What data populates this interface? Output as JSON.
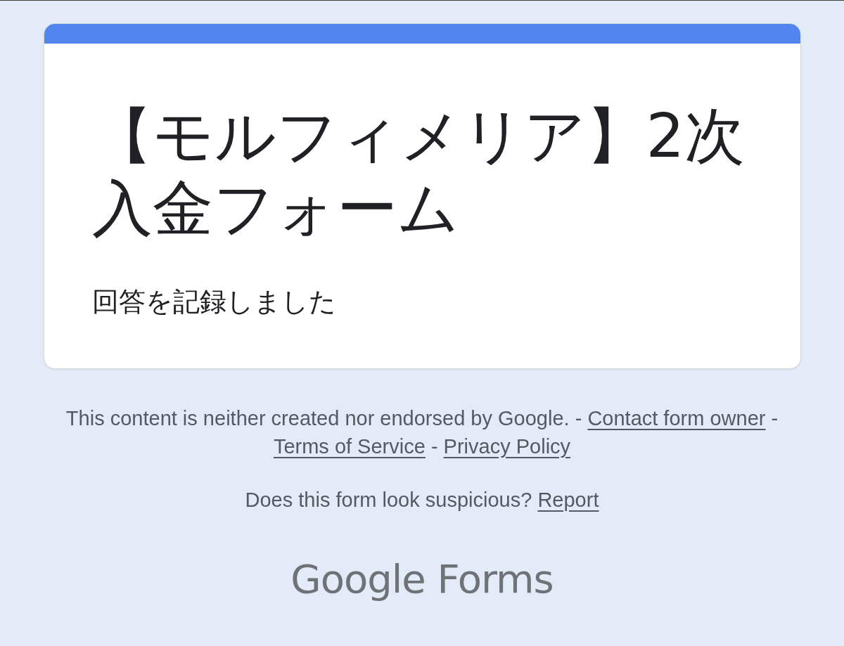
{
  "form": {
    "title": "【モルフィメリア】2次入金フォーム",
    "message": "回答を記録しました"
  },
  "footer": {
    "disclaimer": [
      {
        "kind": "text",
        "text": "This content is neither created nor endorsed by Google. - "
      },
      {
        "kind": "link",
        "text": "Contact form owner"
      },
      {
        "kind": "text",
        "text": " - "
      },
      {
        "kind": "link",
        "text": "Terms of Service"
      },
      {
        "kind": "text",
        "text": " - "
      },
      {
        "kind": "link",
        "text": "Privacy Policy"
      }
    ],
    "report": [
      {
        "kind": "text",
        "text": "Does this form look suspicious? "
      },
      {
        "kind": "link",
        "text": "Report"
      }
    ]
  },
  "logo": {
    "text": "Google Forms"
  }
}
